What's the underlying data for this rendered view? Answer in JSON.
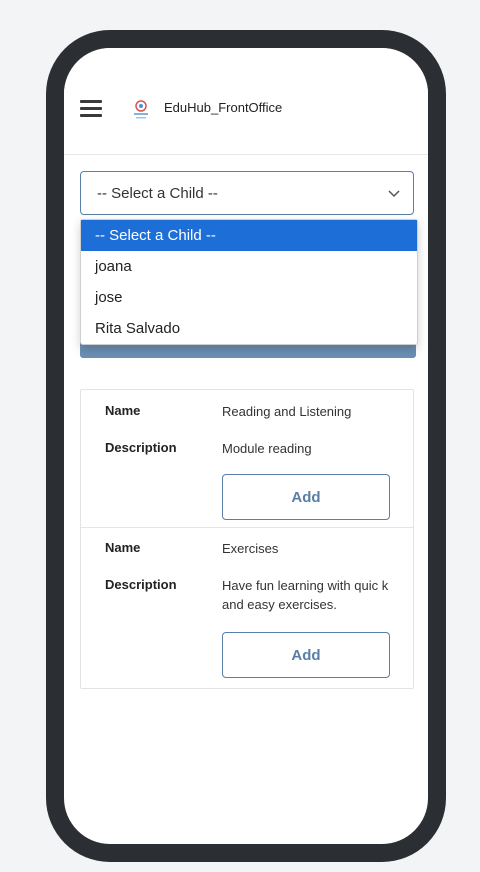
{
  "app": {
    "brand": "EduHub_FrontOffice"
  },
  "child_select": {
    "selected": "-- Select a Child --",
    "options": [
      "-- Select a Child --",
      "joana",
      "jose",
      "Rita Salvado"
    ]
  },
  "modules": [
    {
      "name_label": "Name",
      "name": "Reading and Listening",
      "description_label": "Description",
      "description": "Module reading",
      "add_label": "Add"
    },
    {
      "name_label": "Name",
      "name": "Exercises",
      "description_label": "Description",
      "description": "Have fun learning with quic k and easy exercises.",
      "add_label": "Add"
    }
  ],
  "colors": {
    "accent": "#5a7fa6",
    "selected_option": "#1e6ed8",
    "frame": "#2b2f33"
  }
}
